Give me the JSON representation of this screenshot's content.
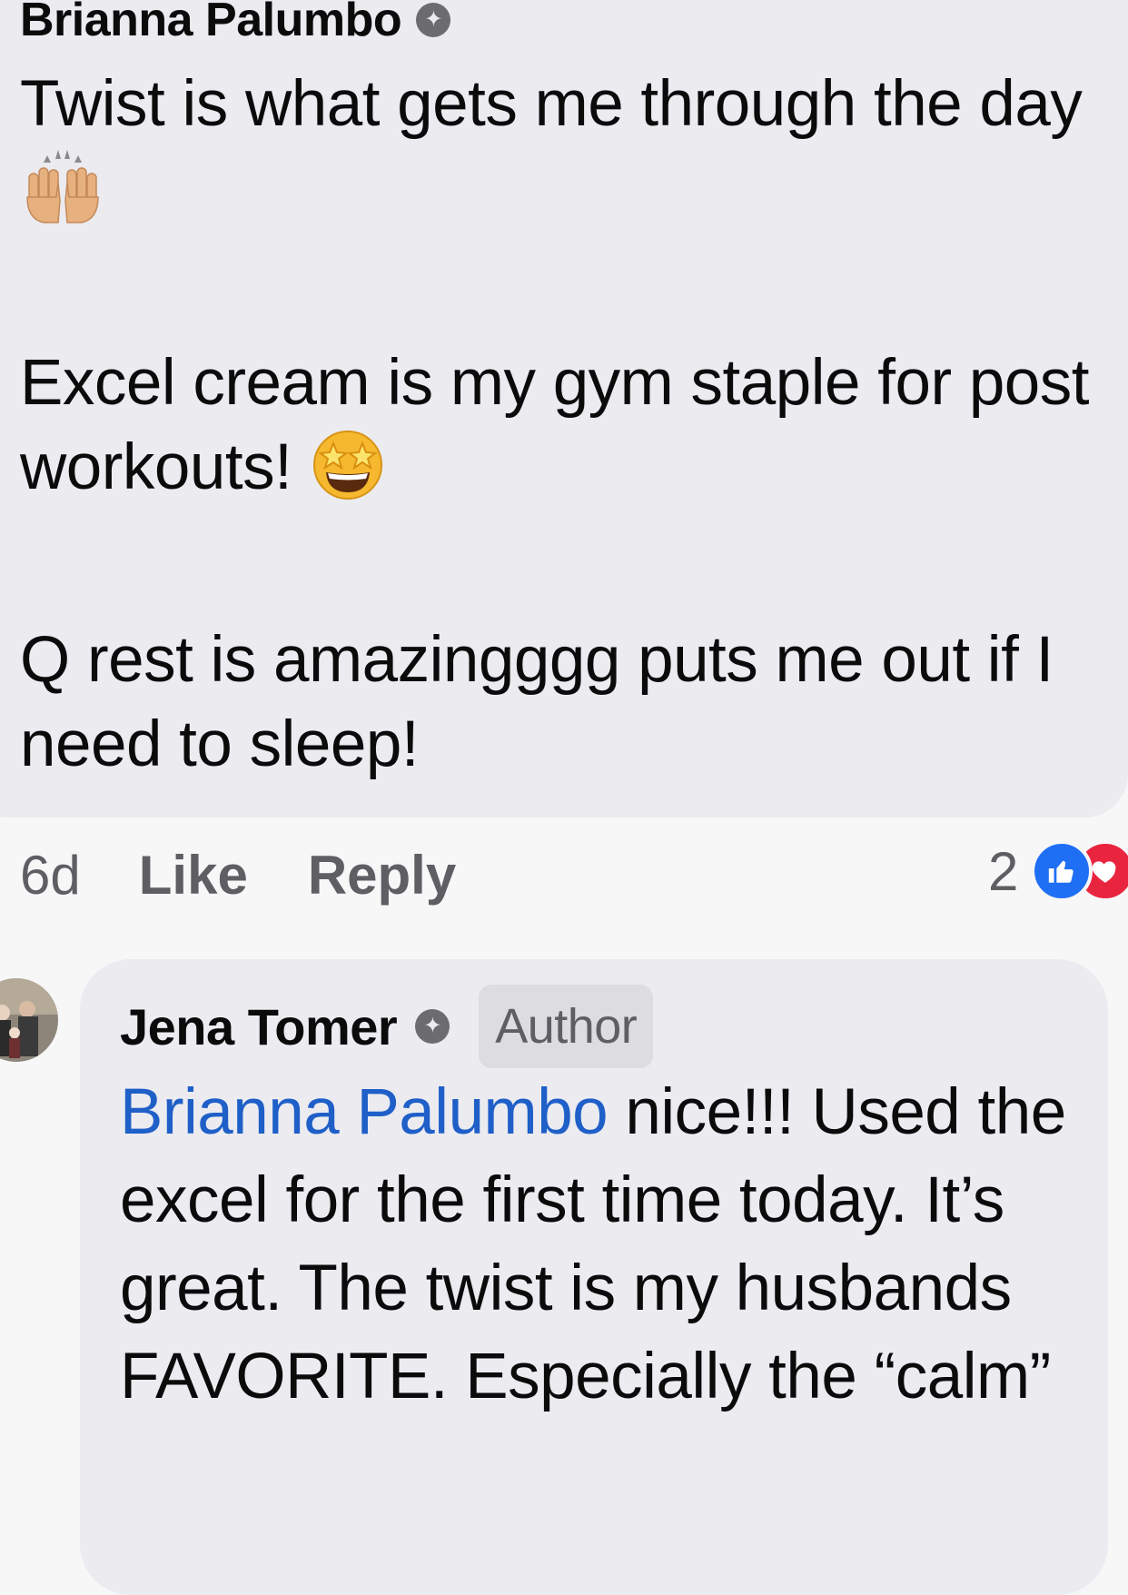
{
  "comment1": {
    "author": "Brianna Palumbo",
    "paragraph1": "Twist is what gets me through the day",
    "paragraph2": "Excel cream is my gym staple for post workouts!",
    "paragraph3": "Q rest is amazingggg puts me out if I need to sleep!",
    "emoji1": "raising-hands-emoji",
    "emoji2": "star-struck-emoji"
  },
  "actions": {
    "time": "6d",
    "like_label": "Like",
    "reply_label": "Reply"
  },
  "reactions": {
    "count": "2",
    "types": [
      "like",
      "love"
    ]
  },
  "comment2": {
    "author": "Jena Tomer",
    "author_tag": "Author",
    "mention": "Brianna Palumbo",
    "text": " nice!!! Used the excel for the first time today. It’s great. The twist is my husbands FAVORITE. Especially the “calm”"
  },
  "colors": {
    "bubble": "#ebebf0",
    "background": "#f7f7f8",
    "mention": "#1f5fc8",
    "like_reaction": "#1f6ff5",
    "love_reaction": "#e8243f"
  }
}
